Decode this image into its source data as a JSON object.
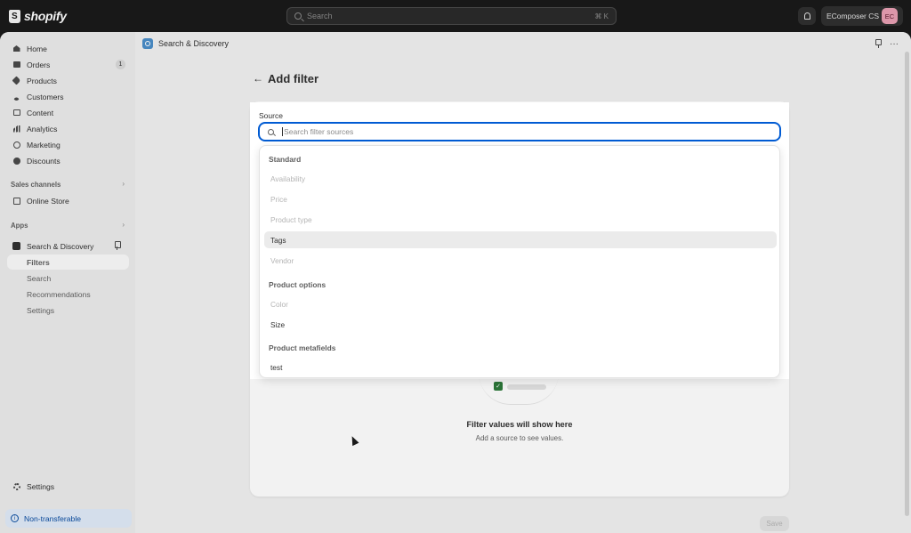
{
  "topbar": {
    "brand": "shopify",
    "search_placeholder": "Search",
    "search_shortcut": "⌘ K",
    "store_name": "EComposer CS",
    "avatar_initials": "EC"
  },
  "sidebar": {
    "items": [
      {
        "label": "Home"
      },
      {
        "label": "Orders",
        "badge": "1"
      },
      {
        "label": "Products"
      },
      {
        "label": "Customers"
      },
      {
        "label": "Content"
      },
      {
        "label": "Analytics"
      },
      {
        "label": "Marketing"
      },
      {
        "label": "Discounts"
      }
    ],
    "sales_channels_label": "Sales channels",
    "online_store_label": "Online Store",
    "apps_label": "Apps",
    "app_name": "Search & Discovery",
    "app_subitems": [
      "Filters",
      "Search",
      "Recommendations",
      "Settings"
    ],
    "settings_label": "Settings",
    "non_transferable_label": "Non-transferable"
  },
  "main": {
    "app_title": "Search & Discovery",
    "page_title": "Add filter",
    "empty_title": "Filter values will show here",
    "empty_subtitle": "Add a source to see values.",
    "save_label": "Save"
  },
  "popover": {
    "source_label": "Source",
    "search_placeholder": "Search filter sources",
    "groups": [
      {
        "label": "Standard",
        "options": [
          {
            "label": "Availability",
            "state": "disabled"
          },
          {
            "label": "Price",
            "state": "disabled"
          },
          {
            "label": "Product type",
            "state": "disabled"
          },
          {
            "label": "Tags",
            "state": "highlighted"
          },
          {
            "label": "Vendor",
            "state": "disabled"
          }
        ]
      },
      {
        "label": "Product options",
        "options": [
          {
            "label": "Color",
            "state": "disabled"
          },
          {
            "label": "Size",
            "state": "enabled"
          }
        ]
      },
      {
        "label": "Product metafields",
        "options": [
          {
            "label": "test",
            "state": "enabled"
          }
        ]
      }
    ]
  },
  "colors": {
    "focus_ring": "#005bd3",
    "topbar_bg": "#1a1a1a",
    "highlight_bg": "#ebebeb",
    "disabled_text": "#b5b5b5"
  }
}
